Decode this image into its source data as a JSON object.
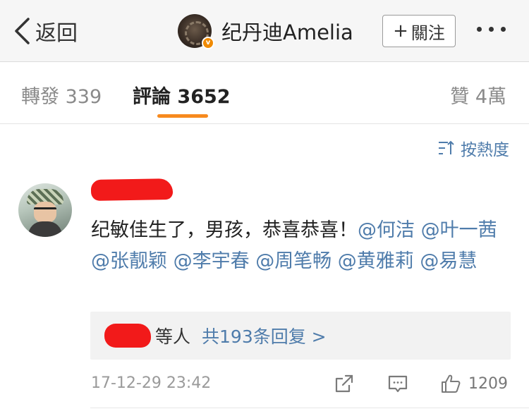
{
  "navbar": {
    "back_label": "返回",
    "profile_name": "纪丹迪Amelia",
    "verified_badge": "v",
    "follow_label": "關注",
    "follow_prefix": "+"
  },
  "tabs": {
    "repost_label": "轉發",
    "repost_count": "339",
    "comments_label": "評論",
    "comments_count": "3652",
    "likes_label": "贊",
    "likes_count": "4萬"
  },
  "sort": {
    "label": "按熱度"
  },
  "comment": {
    "text_prefix": "纪敏佳生了，男孩，恭喜恭喜！",
    "mentions": [
      "@何洁",
      "@叶一茜",
      "@张靓颖",
      "@李宇春",
      "@周笔畅",
      "@黄雅莉",
      "@易慧"
    ],
    "reply_suffix": "等人",
    "reply_link": "共193条回复 >",
    "timestamp": "17-12-29 23:42",
    "like_count": "1209"
  },
  "colors": {
    "accent": "#f78a1e",
    "link": "#4f7cab",
    "redaction": "#f21a1a"
  },
  "icons": {
    "back": "chevron-left-icon",
    "more": "more-dots-icon",
    "sort": "sort-icon",
    "share": "share-icon",
    "comment": "comment-icon",
    "like": "thumbs-up-icon"
  }
}
